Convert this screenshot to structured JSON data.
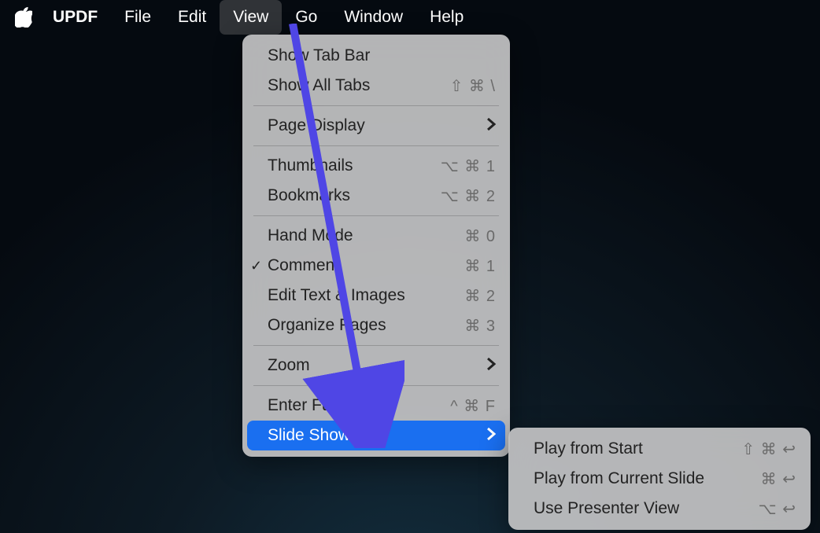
{
  "menubar": {
    "app": "UPDF",
    "items": [
      "File",
      "Edit",
      "View",
      "Go",
      "Window",
      "Help"
    ],
    "active": "View"
  },
  "view_menu": {
    "groups": [
      [
        {
          "label": "Show Tab Bar",
          "shortcut": ""
        },
        {
          "label": "Show All Tabs",
          "shortcut": "⇧ ⌘ \\"
        }
      ],
      [
        {
          "label": "Page Display",
          "submenu": true
        }
      ],
      [
        {
          "label": "Thumbnails",
          "shortcut": "⌥ ⌘ 1"
        },
        {
          "label": "Bookmarks",
          "shortcut": "⌥ ⌘ 2"
        }
      ],
      [
        {
          "label": "Hand Mode",
          "shortcut": "⌘ 0"
        },
        {
          "label": "Comment",
          "shortcut": "⌘ 1",
          "checked": true
        },
        {
          "label": "Edit Text & Images",
          "shortcut": "⌘ 2"
        },
        {
          "label": "Organize Pages",
          "shortcut": "⌘ 3"
        }
      ],
      [
        {
          "label": "Zoom",
          "submenu": true
        }
      ],
      [
        {
          "label": "Enter Full Screen",
          "shortcut": "^ ⌘ F"
        },
        {
          "label": "Slide Show",
          "submenu": true,
          "highlight": true
        }
      ]
    ]
  },
  "slideshow_submenu": [
    {
      "label": "Play from Start",
      "shortcut": "⇧ ⌘ ↩"
    },
    {
      "label": "Play from Current Slide",
      "shortcut": "⌘ ↩"
    },
    {
      "label": "Use Presenter View",
      "shortcut": "⌥ ↩"
    }
  ]
}
